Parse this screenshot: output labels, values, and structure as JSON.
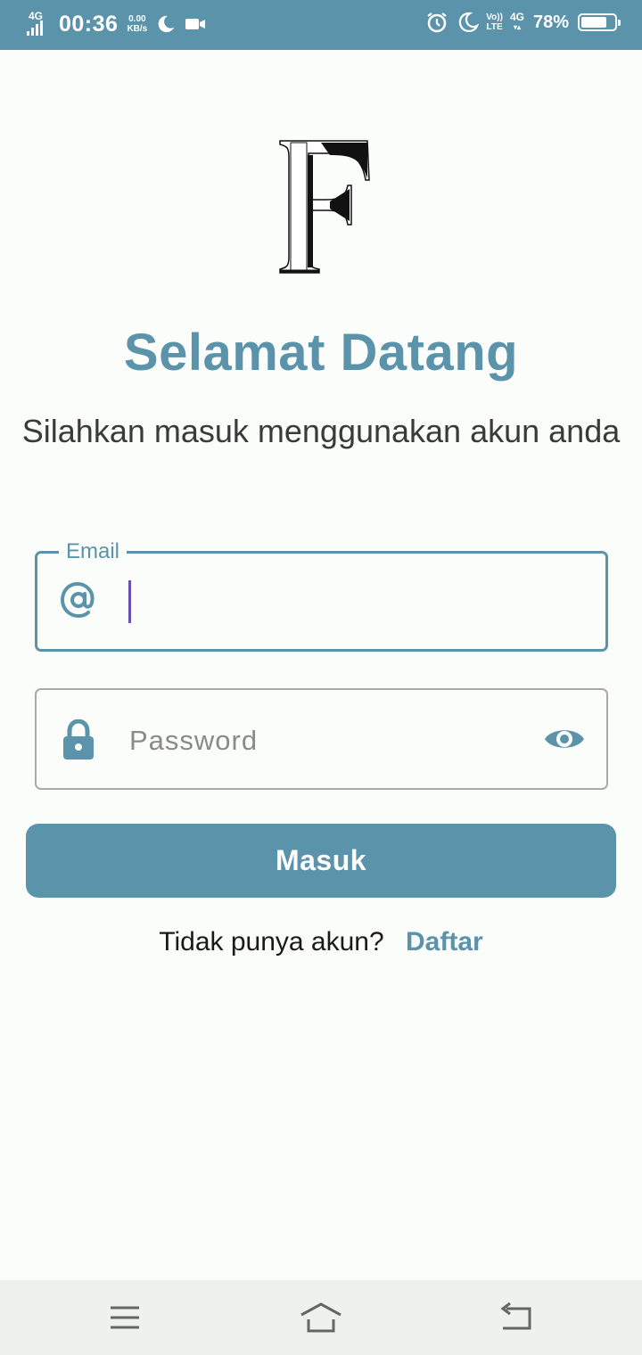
{
  "status_bar": {
    "network": "4G",
    "time": "00:36",
    "speed_value": "0.00",
    "speed_unit": "KB/s",
    "volte_top": "Vo))",
    "volte_bottom": "LTE",
    "network2": "4G",
    "battery_percent": "78%",
    "battery_level": 0.78
  },
  "logo": {
    "letter": "F"
  },
  "welcome": {
    "title": "Selamat Datang",
    "subtitle": "Silahkan masuk menggunakan akun anda"
  },
  "form": {
    "email_label": "Email",
    "email_value": "",
    "password_placeholder": "Password",
    "login_label": "Masuk"
  },
  "register": {
    "prompt": "Tidak punya akun?",
    "link_label": "Daftar"
  },
  "colors": {
    "primary": "#5b93ab",
    "background": "#fbfdfb",
    "caret": "#6a4fb0"
  },
  "icons": {
    "email": "at-icon",
    "password": "lock-icon",
    "visibility": "eye-icon",
    "nav_menu": "menu-icon",
    "nav_home": "home-icon",
    "nav_back": "back-icon"
  }
}
